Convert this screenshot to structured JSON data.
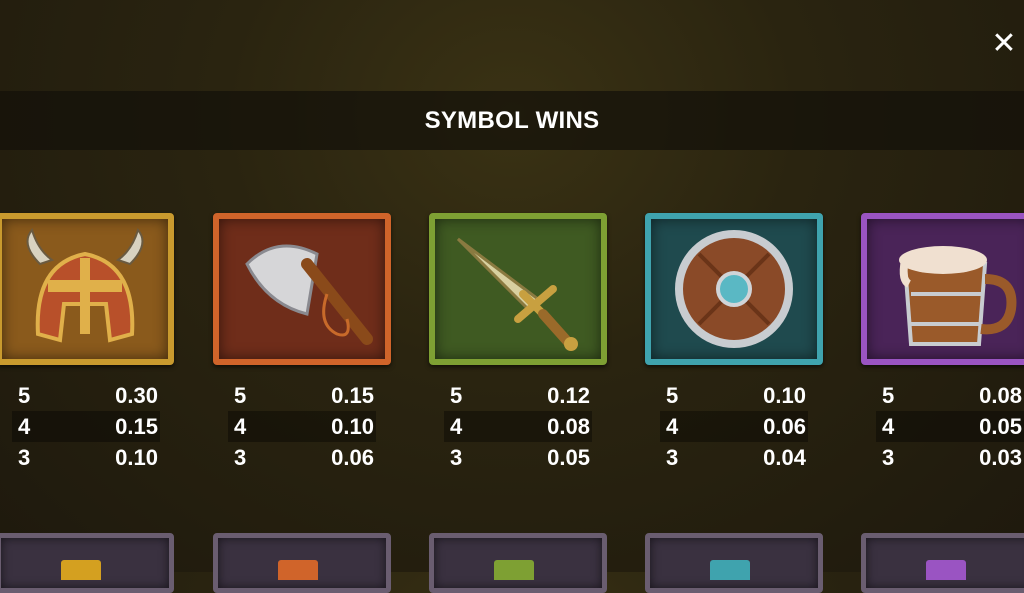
{
  "header": {
    "title": "SYMBOL WINS",
    "close_icon": "close-icon"
  },
  "symbols": [
    {
      "icon": "viking-helmet-icon",
      "color": "#c99a2e",
      "pays": [
        {
          "count": "5",
          "value": "0.30"
        },
        {
          "count": "4",
          "value": "0.15"
        },
        {
          "count": "3",
          "value": "0.10"
        }
      ]
    },
    {
      "icon": "battle-axe-icon",
      "color": "#d0642a",
      "pays": [
        {
          "count": "5",
          "value": "0.15"
        },
        {
          "count": "4",
          "value": "0.10"
        },
        {
          "count": "3",
          "value": "0.06"
        }
      ]
    },
    {
      "icon": "dagger-icon",
      "color": "#7ea033",
      "pays": [
        {
          "count": "5",
          "value": "0.12"
        },
        {
          "count": "4",
          "value": "0.08"
        },
        {
          "count": "3",
          "value": "0.05"
        }
      ]
    },
    {
      "icon": "round-shield-icon",
      "color": "#3fa3ae",
      "pays": [
        {
          "count": "5",
          "value": "0.10"
        },
        {
          "count": "4",
          "value": "0.06"
        },
        {
          "count": "3",
          "value": "0.04"
        }
      ]
    },
    {
      "icon": "ale-tankard-icon",
      "color": "#9a54c2",
      "pays": [
        {
          "count": "5",
          "value": "0.08"
        },
        {
          "count": "4",
          "value": "0.05"
        },
        {
          "count": "3",
          "value": "0.03"
        }
      ]
    }
  ],
  "lower_symbols_colors": [
    "#d4a020",
    "#d0642a",
    "#7ea033",
    "#3fa3ae",
    "#9a54c2"
  ]
}
